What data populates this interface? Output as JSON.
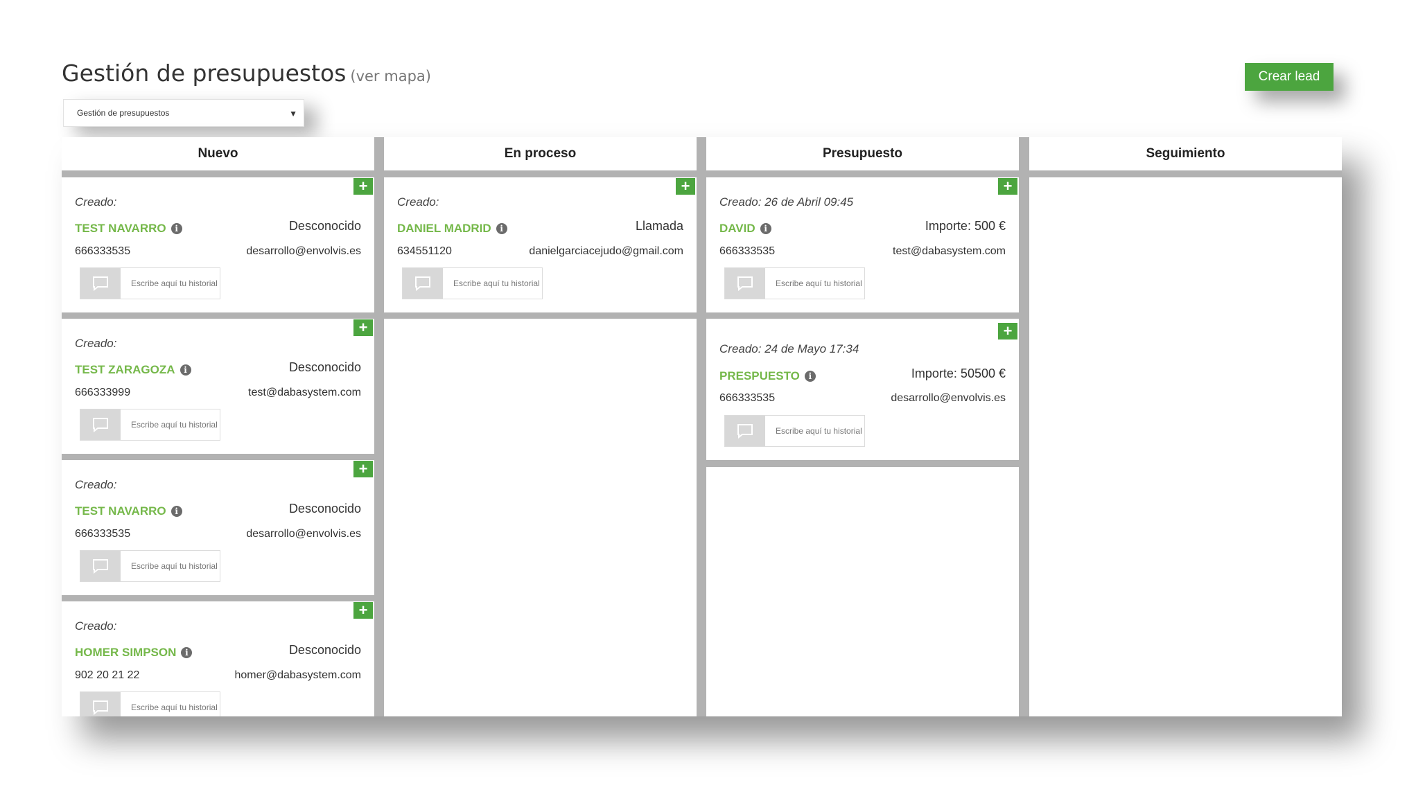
{
  "header": {
    "title": "Gestión de presupuestos",
    "map_link": "(ver mapa)",
    "create_button": "Crear lead",
    "select_value": "Gestión de presupuestos"
  },
  "note_placeholder": "Escribe aquí tu historial",
  "created_label": "Creado:",
  "columns": [
    {
      "title": "Nuevo"
    },
    {
      "title": "En proceso"
    },
    {
      "title": "Presupuesto"
    },
    {
      "title": "Seguimiento"
    }
  ],
  "cards": {
    "nuevo": [
      {
        "created": "Creado:",
        "name": "TEST NAVARRO",
        "status": "Desconocido",
        "phone": "666333535",
        "email": "desarrollo@envolvis.es"
      },
      {
        "created": "Creado:",
        "name": "TEST ZARAGOZA",
        "status": "Desconocido",
        "phone": "666333999",
        "email": "test@dabasystem.com"
      },
      {
        "created": "Creado:",
        "name": "TEST NAVARRO",
        "status": "Desconocido",
        "phone": "666333535",
        "email": "desarrollo@envolvis.es"
      },
      {
        "created": "Creado:",
        "name": "HOMER SIMPSON",
        "status": "Desconocido",
        "phone": "902 20 21 22",
        "email": "homer@dabasystem.com"
      }
    ],
    "en_proceso": [
      {
        "created": "Creado:",
        "name": "DANIEL MADRID",
        "status": "Llamada",
        "phone": "634551120",
        "email": "danielgarciacejudo@gmail.com"
      }
    ],
    "presupuesto": [
      {
        "created": "Creado: 26 de Abril 09:45",
        "name": "DAVID",
        "status": "Importe: 500 €",
        "phone": "666333535",
        "email": "test@dabasystem.com"
      },
      {
        "created": "Creado: 24 de Mayo 17:34",
        "name": "PRESPUESTO",
        "status": "Importe: 50500 €",
        "phone": "666333535",
        "email": "desarrollo@envolvis.es"
      }
    ]
  },
  "colors": {
    "accent_green": "#4ca53f",
    "lead_name_green": "#75b84a",
    "board_gray": "#b2b2b2"
  },
  "icons": {
    "add": "plus-icon",
    "info": "info-icon",
    "note": "comment-icon",
    "dropdown": "caret-down-icon"
  }
}
